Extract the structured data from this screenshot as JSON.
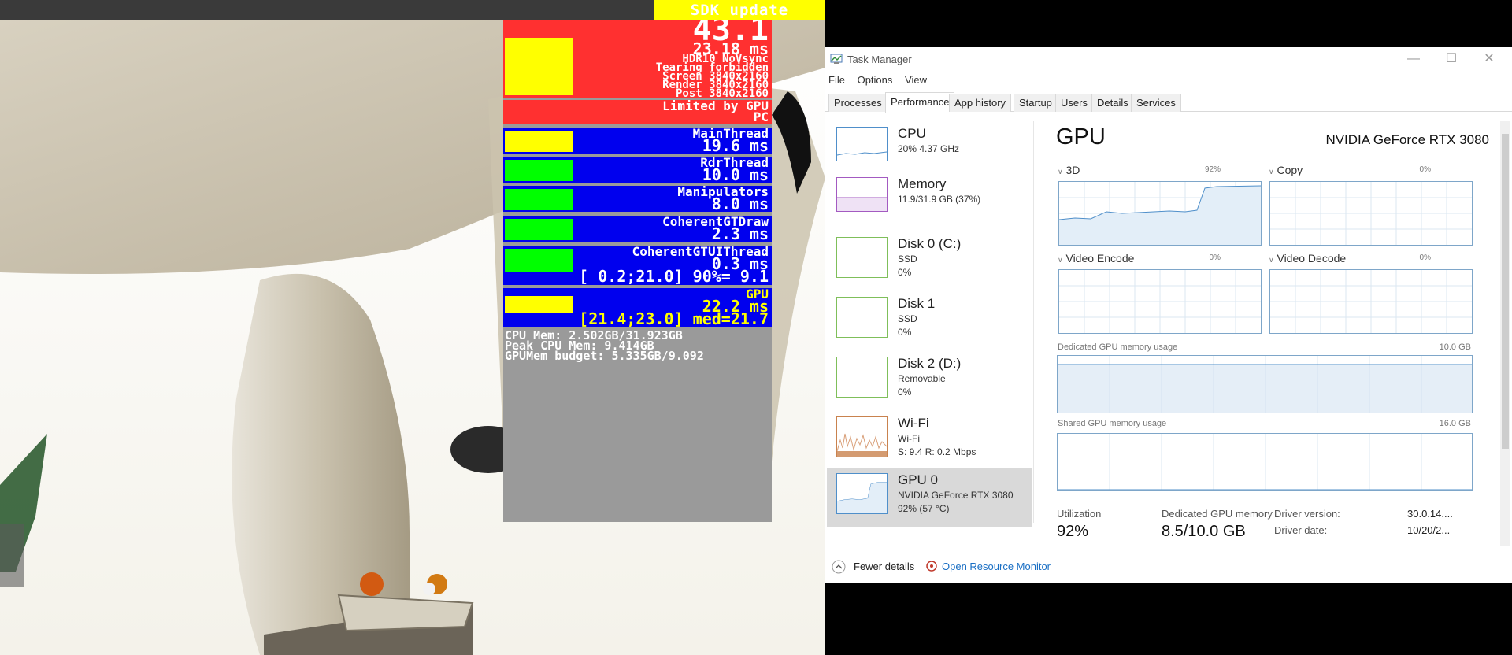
{
  "game": {
    "sdk_banner": "SDK update available",
    "overlay": {
      "fps": "43.1",
      "frame_ms": "23.18 ms",
      "hdr": "HDR10 NoVsync",
      "tearing": "Tearing forbidden",
      "screen": "Screen 3840x2160",
      "render": "Render 3840x2160",
      "post": "Post 3840x2160",
      "limited_by": "Limited by GPU",
      "pc": "PC",
      "threads": [
        {
          "name": "MainThread",
          "value": "19.6 ms",
          "color": "#ffff00"
        },
        {
          "name": "RdrThread",
          "value": "10.0 ms",
          "color": "#00ff00"
        },
        {
          "name": "Manipulators",
          "value": "8.0 ms",
          "color": "#00ff00"
        },
        {
          "name": "CoherentGTDraw",
          "value": "2.3 ms",
          "color": "#00ff00"
        },
        {
          "name": "CoherentGTUIThread",
          "value": "0.3 ms",
          "color": "#00ff00",
          "extra": "[ 0.2;21.0] 90%= 9.1"
        }
      ],
      "gpu": {
        "name": "GPU",
        "value": "22.2 ms",
        "extra": "[21.4;23.0] med=21.7"
      },
      "cpu_mem": "CPU Mem: 2.502GB/31.923GB",
      "peak_cpu_mem": "Peak CPU Mem: 9.414GB",
      "gpu_mem_budget": "GPUMem budget: 5.335GB/9.092"
    }
  },
  "taskmanager": {
    "title": "Task Manager",
    "menu": [
      "File",
      "Options",
      "View"
    ],
    "tabs": [
      "Processes",
      "Performance",
      "App history",
      "Startup",
      "Users",
      "Details",
      "Services"
    ],
    "active_tab": "Performance",
    "sidebar": [
      {
        "name": "CPU",
        "line1": "20% 4.37 GHz",
        "line2": ""
      },
      {
        "name": "Memory",
        "line1": "11.9/31.9 GB (37%)",
        "line2": ""
      },
      {
        "name": "Disk 0 (C:)",
        "line1": "SSD",
        "line2": "0%"
      },
      {
        "name": "Disk 1",
        "line1": "SSD",
        "line2": "0%"
      },
      {
        "name": "Disk 2 (D:)",
        "line1": "Removable",
        "line2": "0%"
      },
      {
        "name": "Wi-Fi",
        "line1": "Wi-Fi",
        "line2": "S: 9.4  R: 0.2 Mbps"
      },
      {
        "name": "GPU 0",
        "line1": "NVIDIA GeForce RTX 3080",
        "line2": "92% (57 °C)"
      }
    ],
    "gpu": {
      "heading": "GPU",
      "model": "NVIDIA GeForce RTX 3080",
      "engines": [
        {
          "label": "3D",
          "pct": "92%"
        },
        {
          "label": "Copy",
          "pct": "0%"
        },
        {
          "label": "Video Encode",
          "pct": "0%"
        },
        {
          "label": "Video Decode",
          "pct": "0%"
        }
      ],
      "dedicated_label": "Dedicated GPU memory usage",
      "dedicated_max": "10.0 GB",
      "shared_label": "Shared GPU memory usage",
      "shared_max": "16.0 GB",
      "utilization_label": "Utilization",
      "utilization_value": "92%",
      "dedicated_mem_label": "Dedicated GPU memory",
      "dedicated_mem_value": "8.5/10.0 GB",
      "driver_version_label": "Driver version:",
      "driver_version_value": "30.0.14....",
      "driver_date_label": "Driver date:",
      "driver_date_value": "10/20/2..."
    },
    "footer": {
      "fewer_details": "Fewer details",
      "open_resource_monitor": "Open Resource Monitor"
    }
  }
}
